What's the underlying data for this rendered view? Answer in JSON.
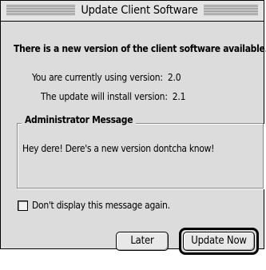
{
  "window": {
    "title": "Update Client Software"
  },
  "message": {
    "headline": "There is a new version of the client software available.",
    "current_label": "You are currently using version:",
    "current_version": "2.0",
    "install_label": "The update will install version:",
    "install_version": "2.1"
  },
  "admin_message": {
    "title": "Administrator Message",
    "body": "Hey dere! Dere's a new version dontcha know!"
  },
  "checkbox": {
    "label": "Don't display this message again.",
    "checked": false
  },
  "buttons": {
    "later": "Later",
    "update_now": "Update Now"
  }
}
